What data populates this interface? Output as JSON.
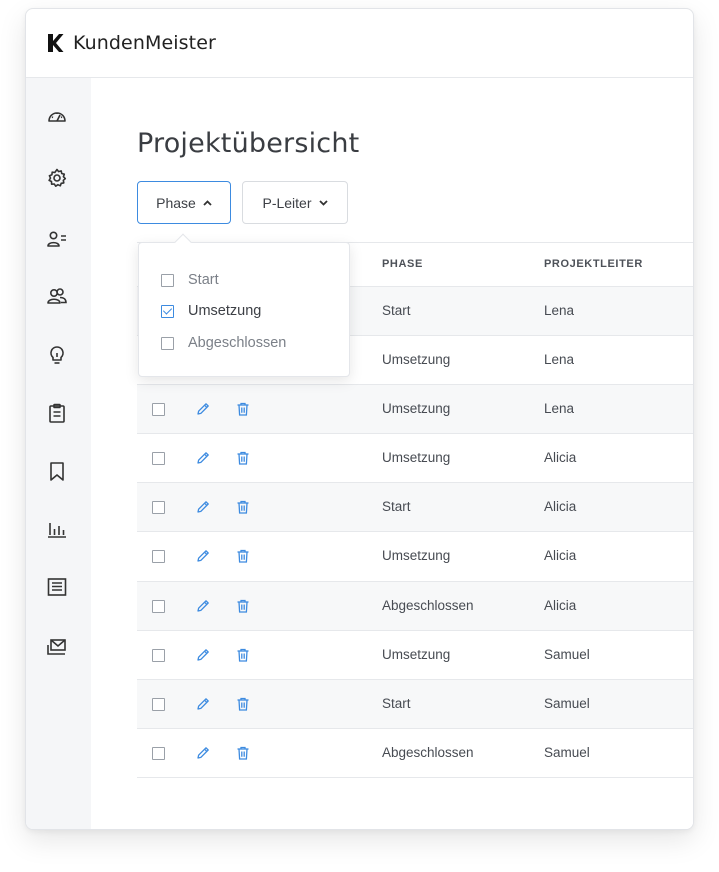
{
  "brand": {
    "name": "KundenMeister"
  },
  "sidebar": {
    "items": [
      {
        "icon": "dashboard-icon"
      },
      {
        "icon": "gear-icon"
      },
      {
        "icon": "user-list-icon"
      },
      {
        "icon": "users-icon"
      },
      {
        "icon": "lightbulb-icon"
      },
      {
        "icon": "clipboard-icon"
      },
      {
        "icon": "bookmark-icon"
      },
      {
        "icon": "bar-chart-icon"
      },
      {
        "icon": "report-icon"
      },
      {
        "icon": "mail-tray-icon"
      }
    ]
  },
  "page": {
    "title": "Projektübersicht"
  },
  "filters": {
    "phase_label": "Phase",
    "leiter_label": "P-Leiter"
  },
  "dropdown": {
    "options": [
      {
        "label": "Start",
        "checked": false
      },
      {
        "label": "Umsetzung",
        "checked": true
      },
      {
        "label": "Abgeschlossen",
        "checked": false
      }
    ]
  },
  "table": {
    "headers": {
      "phase": "PHASE",
      "leiter": "PROJEKTLEITER"
    },
    "rows": [
      {
        "phase": "Start",
        "leiter": "Lena"
      },
      {
        "phase": "Umsetzung",
        "leiter": "Lena"
      },
      {
        "phase": "Umsetzung",
        "leiter": "Lena"
      },
      {
        "phase": "Umsetzung",
        "leiter": "Alicia"
      },
      {
        "phase": "Start",
        "leiter": "Alicia"
      },
      {
        "phase": "Umsetzung",
        "leiter": "Alicia"
      },
      {
        "phase": "Abgeschlossen",
        "leiter": "Alicia"
      },
      {
        "phase": "Umsetzung",
        "leiter": "Samuel"
      },
      {
        "phase": "Start",
        "leiter": "Samuel"
      },
      {
        "phase": "Abgeschlossen",
        "leiter": "Samuel"
      }
    ]
  },
  "colors": {
    "accent": "#3d8be0",
    "sidebar_bg": "#f5f6f8"
  }
}
